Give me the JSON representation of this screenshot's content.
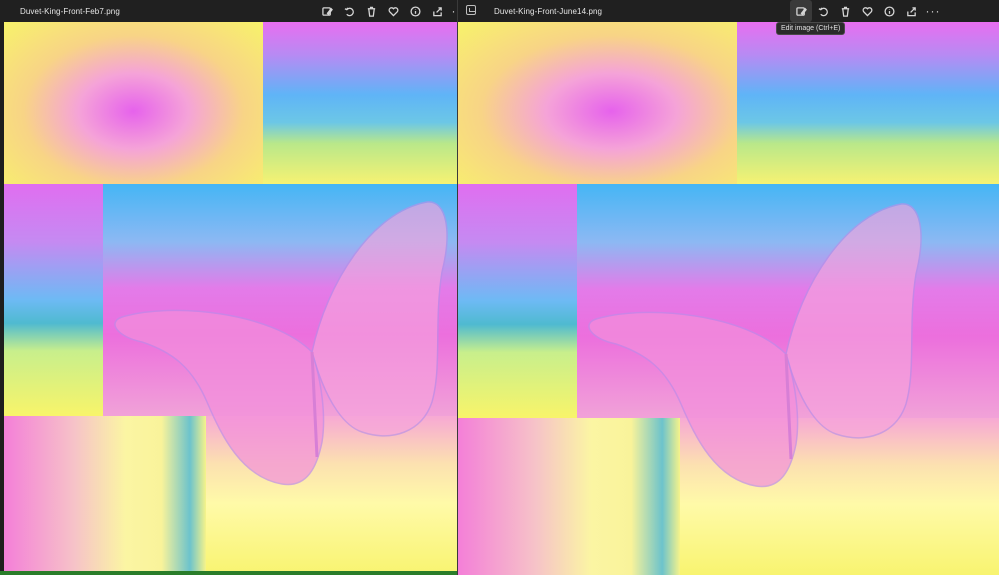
{
  "left_window": {
    "title": "Duvet-King-Front-Feb7.png",
    "toolbar": [
      "edit-image-icon",
      "rotate-icon",
      "delete-icon",
      "favorite-icon",
      "info-icon",
      "share-icon",
      "more-icon"
    ],
    "more_label": "···"
  },
  "right_window": {
    "title": "Duvet-King-Front-June14.png",
    "toolbar": [
      "edit-image-icon",
      "rotate-icon",
      "delete-icon",
      "favorite-icon",
      "info-icon",
      "share-icon",
      "more-icon"
    ],
    "more_label": "···",
    "tooltip": "Edit image (Ctrl+E)"
  },
  "colors": {
    "pink": "#f06fe0",
    "magenta": "#e25bf0",
    "blue": "#45b2f5",
    "yellow": "#f7f36a",
    "pale_yellow": "#fffaa8",
    "teal": "#57b8b0",
    "butterfly": "#f58ad6",
    "status_green": "#2a7d2a"
  }
}
